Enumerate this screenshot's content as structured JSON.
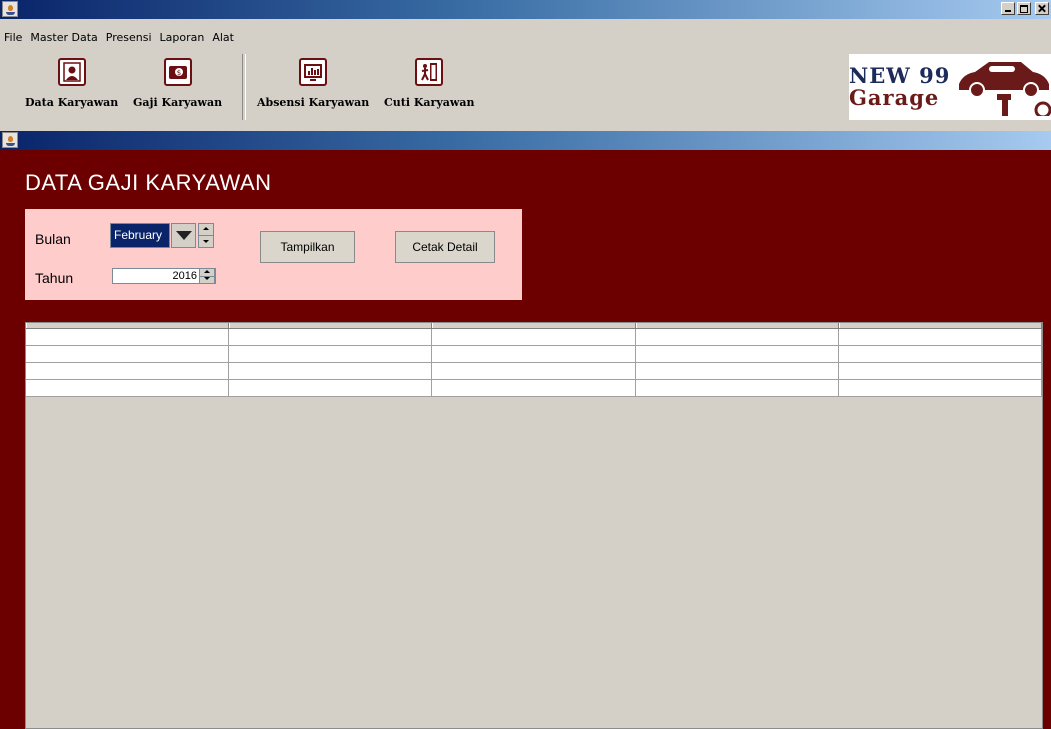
{
  "menubar": {
    "items": [
      "File",
      "Master Data",
      "Presensi",
      "Laporan",
      "Alat"
    ]
  },
  "toolbar": {
    "data_karyawan_label": "Data Karyawan",
    "gaji_karyawan_label": "Gaji Karyawan",
    "absensi_karyawan_label": "Absensi Karyawan",
    "cuti_karyawan_label": "Cuti Karyawan"
  },
  "logo": {
    "line1": "NEW 99",
    "line2": "Garage"
  },
  "page": {
    "title": "DATA GAJI KARYAWAN"
  },
  "filter": {
    "bulan_label": "Bulan",
    "bulan_value": "February",
    "tahun_label": "Tahun",
    "tahun_value": "2016",
    "tampilkan_label": "Tampilkan",
    "cetak_label": "Cetak Detail"
  },
  "table": {
    "headers": [
      "",
      "",
      "",
      "",
      ""
    ],
    "rows": [
      [
        "",
        "",
        "",
        "",
        ""
      ],
      [
        "",
        "",
        "",
        "",
        ""
      ],
      [
        "",
        "",
        "",
        "",
        ""
      ],
      [
        "",
        "",
        "",
        "",
        ""
      ]
    ]
  },
  "colors": {
    "content_bg": "#6c0000",
    "filter_bg": "#ffcccc",
    "titlebar_start": "#0a246a",
    "titlebar_end": "#a6caf0"
  }
}
